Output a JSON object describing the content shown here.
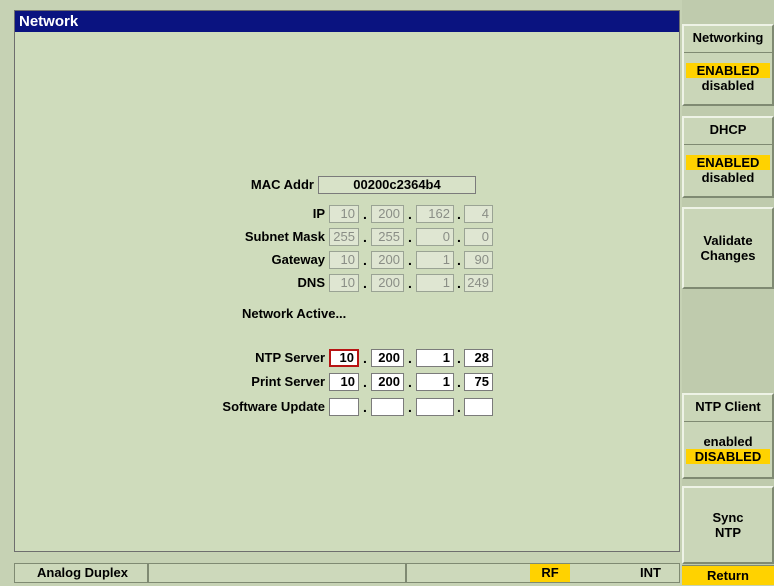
{
  "window": {
    "title": "Network"
  },
  "form": {
    "mac_label": "MAC Addr",
    "mac_value": "00200c2364b4",
    "ip_label": "IP",
    "ip": [
      "10",
      "200",
      "162",
      "4"
    ],
    "mask_label": "Subnet Mask",
    "mask": [
      "255",
      "255",
      "0",
      "0"
    ],
    "gateway_label": "Gateway",
    "gateway": [
      "10",
      "200",
      "1",
      "90"
    ],
    "dns_label": "DNS",
    "dns": [
      "10",
      "200",
      "1",
      "249"
    ],
    "status": "Network Active...",
    "ntp_label": "NTP Server",
    "ntp": [
      "10",
      "200",
      "1",
      "28"
    ],
    "print_label": "Print Server",
    "print": [
      "10",
      "200",
      "1",
      "75"
    ],
    "update_label": "Software Update",
    "update": [
      "",
      "",
      "",
      ""
    ],
    "dot": "."
  },
  "sidebar": {
    "networking": {
      "label": "Networking",
      "enabled": "ENABLED",
      "disabled": "disabled"
    },
    "dhcp": {
      "label": "DHCP",
      "enabled": "ENABLED",
      "disabled": "disabled"
    },
    "validate": {
      "line1": "Validate",
      "line2": "Changes"
    },
    "ntp_client": {
      "label": "NTP Client",
      "enabled": "enabled",
      "disabled": "DISABLED"
    },
    "sync": {
      "line1": "Sync",
      "line2": "NTP"
    },
    "return_label": "Return"
  },
  "footer": {
    "mode": "Analog Duplex",
    "rf": "RF",
    "int": "INT"
  },
  "colors": {
    "title_bg": "#0a1380",
    "highlight": "#ffd200",
    "focus_border": "#b81414"
  }
}
